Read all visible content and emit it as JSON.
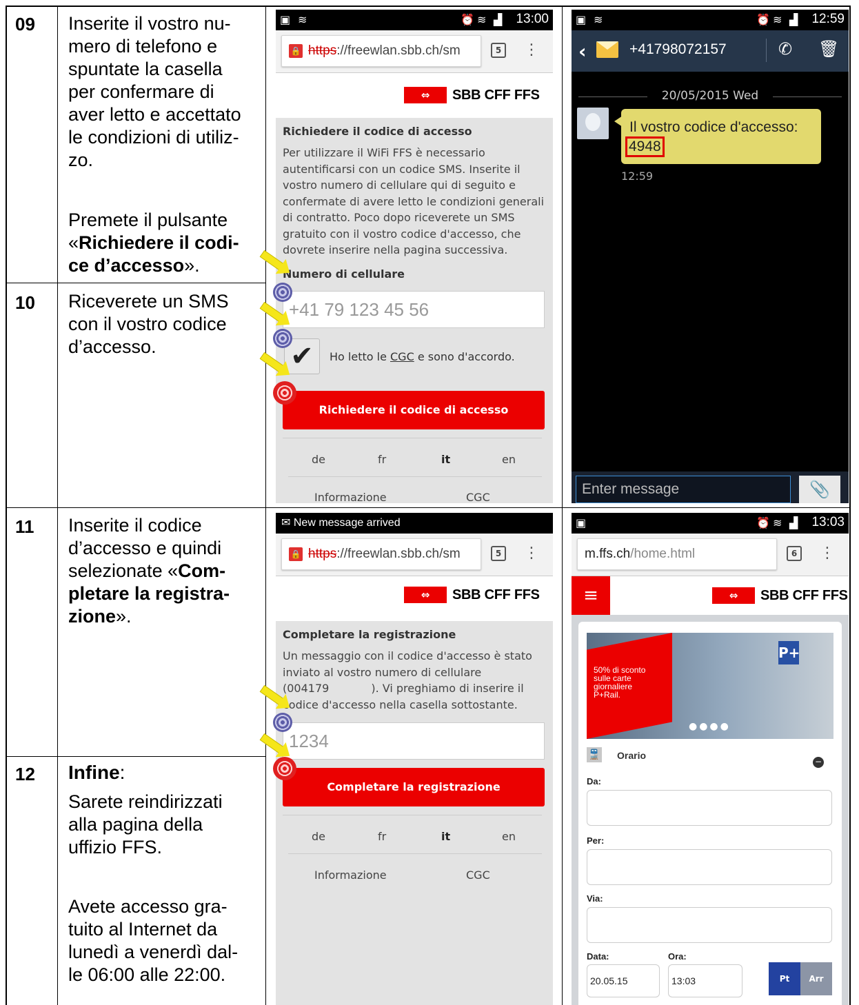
{
  "rows": [
    {
      "num": "09",
      "lines": [
        "Inserite il vostro nu-",
        "mero di telefono e",
        "spuntate la casella",
        "per confermare di",
        "aver letto e accettato",
        "le condizioni di utiliz-",
        "zo."
      ],
      "press_prefix": "Premete il pulsante",
      "press_open": "«",
      "press_bold1": "Richiedere il codi-",
      "press_bold2": "ce d’accesso",
      "press_close": "»."
    },
    {
      "num": "10",
      "lines": [
        "Riceverete un SMS",
        "con il vostro codice",
        "d’accesso."
      ]
    },
    {
      "num": "11",
      "line1": "Inserite il codice",
      "line2": "d’accesso e quindi",
      "line3_prefix": "selezionate «",
      "line3_bold": "Com-",
      "line4_bold": "pletare la registra-",
      "line5_bold": "zione",
      "line5_suffix": "»."
    },
    {
      "num": "12",
      "bold": "Infine",
      "colon": ":",
      "lines_a": [
        "Sarete reindirizzati",
        "alla pagina della",
        "uffizio FFS."
      ],
      "lines_b": [
        "Avete accesso gra-",
        "tuito al Internet da",
        "lunedì a venerdì dal-",
        "le 06:00 alle 22:00."
      ]
    }
  ],
  "screen1": {
    "time": "13:00",
    "url_scheme": "https",
    "url_rest": "://freewlan.sbb.ch/sm",
    "tabs": "5",
    "logo_text": "SBB CFF FFS",
    "heading": "Richiedere il codice di accesso",
    "paragraph": [
      "Per utilizzare il WiFi FFS è necessario",
      "autentificarsi con un codice SMS. Inserite il",
      "vostro numero di cellulare qui di seguito e",
      "confermate di avere letto le condizioni generali",
      "di contratto. Poco dopo riceverete un SMS",
      "gratuito con il vostro codice d'accesso, che",
      "dovrete inserire nella pagina successiva."
    ],
    "phone_label": "Numero di cellulare",
    "phone_placeholder": "+41 79 123 45 56",
    "checkbox_prefix": "Ho letto le ",
    "checkbox_link": "CGC",
    "checkbox_suffix": " e sono d'accordo.",
    "button": "Richiedere il codice di accesso",
    "langs": [
      "de",
      "fr",
      "it",
      "en"
    ],
    "footer": [
      "Informazione",
      "CGC"
    ]
  },
  "screen2": {
    "time": "12:59",
    "contact": "+41798072157",
    "date": "20/05/2015 Wed",
    "message": "Il vostro codice d'accesso:",
    "code": "4948",
    "msg_time": "12:59",
    "input_placeholder": "Enter message"
  },
  "screen3": {
    "notification": "New message arrived",
    "url_scheme": "https",
    "url_rest": "://freewlan.sbb.ch/sm",
    "tabs": "5",
    "logo_text": "SBB CFF FFS",
    "heading": "Completare la registrazione",
    "paragraph": [
      "Un messaggio con il codice d'accesso è stato",
      "inviato al vostro numero di cellulare",
      "(004179            ). Vi preghiamo di inserire il",
      "codice d'accesso nella casella sottostante."
    ],
    "code_placeholder": "1234",
    "button": "Completare la registrazione",
    "langs": [
      "de",
      "fr",
      "it",
      "en"
    ],
    "footer": [
      "Informazione",
      "CGC"
    ]
  },
  "screen4": {
    "time": "13:03",
    "url_host": "m.ffs.ch",
    "url_path": "/home.html",
    "tabs": "6",
    "logo_text": "SBB CFF FFS",
    "banner_text": [
      "50% di sconto",
      "sulle carte",
      "giornaliere",
      "P+Rail."
    ],
    "banner_p": "P+",
    "section_title": "Orario",
    "label_da": "Da:",
    "label_per": "Per:",
    "label_via": "Via:",
    "label_data": "Data:",
    "label_ora": "Ora:",
    "data_value": "20.05.15",
    "ora_value": "13:03",
    "btn_pt": "Pt",
    "btn_arr": "Arr"
  },
  "colors": {
    "sbb_red": "#eb0000",
    "sms_header": "#26364a",
    "bubble": "#e2d96e"
  }
}
